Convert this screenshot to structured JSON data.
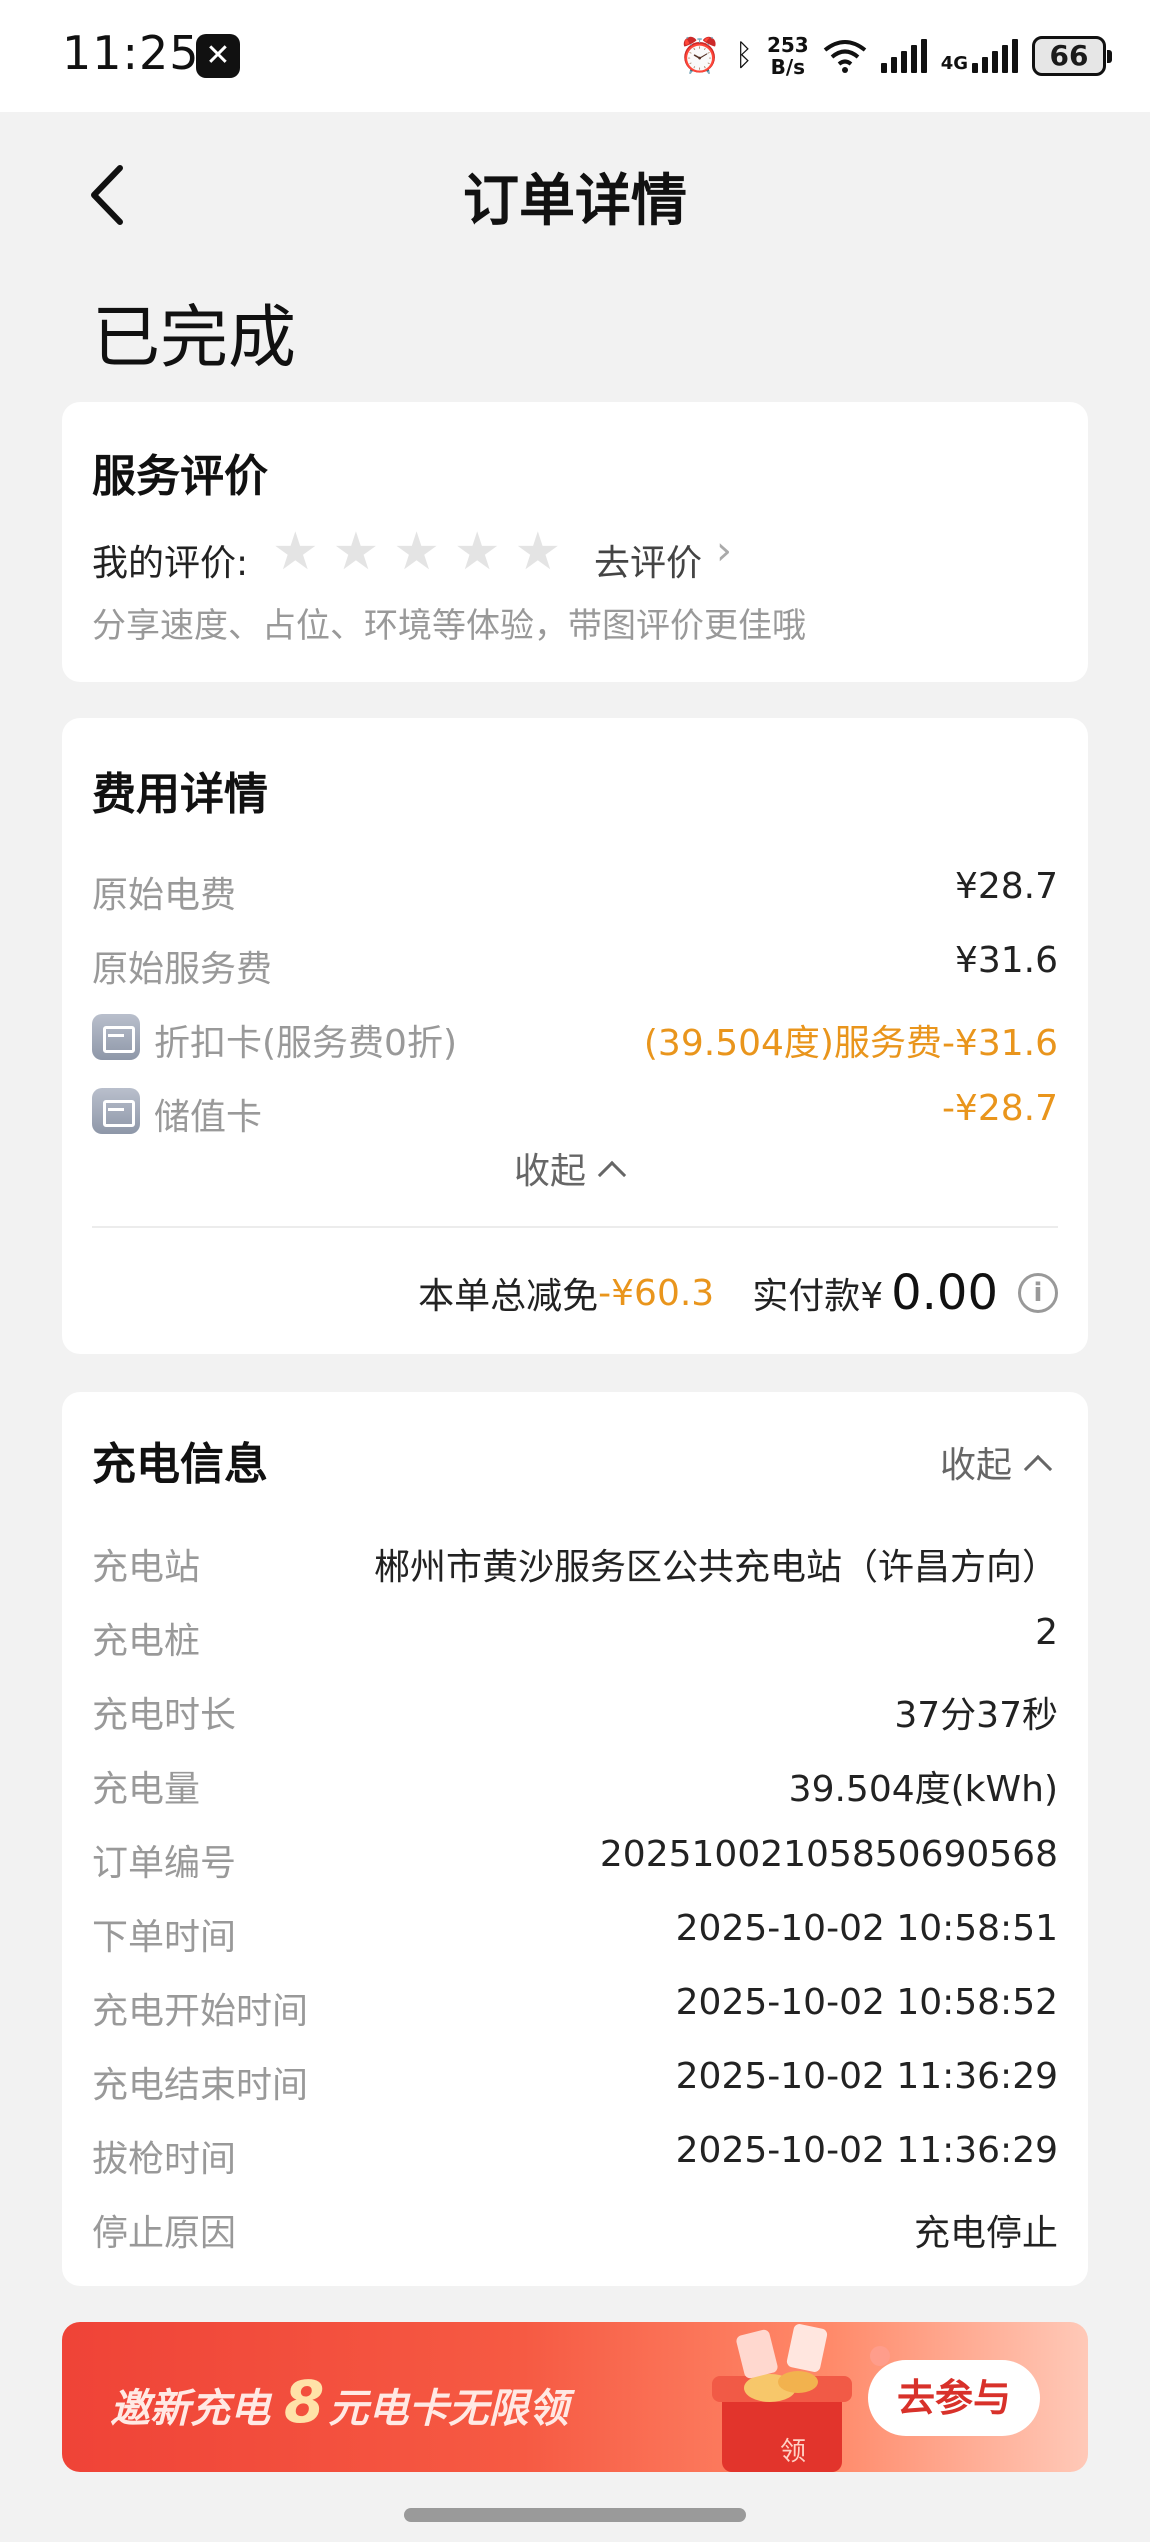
{
  "status_bar": {
    "time": "11:25",
    "app_icon": "close-x-icon",
    "speed_top": "253",
    "speed_bottom": "B/s",
    "network": "4G",
    "battery": "66"
  },
  "header": {
    "title": "订单详情",
    "back_icon": "back-arrow-icon"
  },
  "order_status": "已完成",
  "service_eval": {
    "title": "服务评价",
    "my_rating_label": "我的评价:",
    "stars_filled": 0,
    "stars_total": 5,
    "go_rate": "去评价",
    "hint": "分享速度、占位、环境等体验，带图评价更佳哦"
  },
  "fees": {
    "title": "费用详情",
    "rows": [
      {
        "label": "原始电费",
        "value": "¥28.7"
      },
      {
        "label": "原始服务费",
        "value": "¥31.6"
      },
      {
        "label": "折扣卡(服务费0折)",
        "value": "(39.504度)服务费-¥31.6"
      },
      {
        "label": "储值卡",
        "value": "-¥28.7"
      }
    ],
    "collapse": "收起",
    "total_discount_label": "本单总减免",
    "total_discount_value": "-¥60.3",
    "paid_label": "实付款¥",
    "paid_value": "0.00",
    "info_glyph": "i"
  },
  "charging": {
    "title": "充电信息",
    "collapse": "收起",
    "rows": [
      {
        "label": "充电站",
        "value": "郴州市黄沙服务区公共充电站（许昌方向）"
      },
      {
        "label": "充电桩",
        "value": "2"
      },
      {
        "label": "充电时长",
        "value": "37分37秒"
      },
      {
        "label": "充电量",
        "value": "39.504度(kWh)"
      },
      {
        "label": "订单编号",
        "value": "20251002105850690568"
      },
      {
        "label": "下单时间",
        "value": "2025-10-02 10:58:51"
      },
      {
        "label": "充电开始时间",
        "value": "2025-10-02 10:58:52"
      },
      {
        "label": "充电结束时间",
        "value": "2025-10-02 11:36:29"
      },
      {
        "label": "拔枪时间",
        "value": "2025-10-02 11:36:29"
      },
      {
        "label": "停止原因",
        "value": "充电停止"
      }
    ]
  },
  "banner": {
    "text_a": "邀新充电",
    "text_big": "8",
    "text_b": "元电卡无限领",
    "button": "去参与",
    "deco_char": "领"
  },
  "colors": {
    "accent_orange": "#e9951c",
    "banner_red": "#ef4337"
  }
}
